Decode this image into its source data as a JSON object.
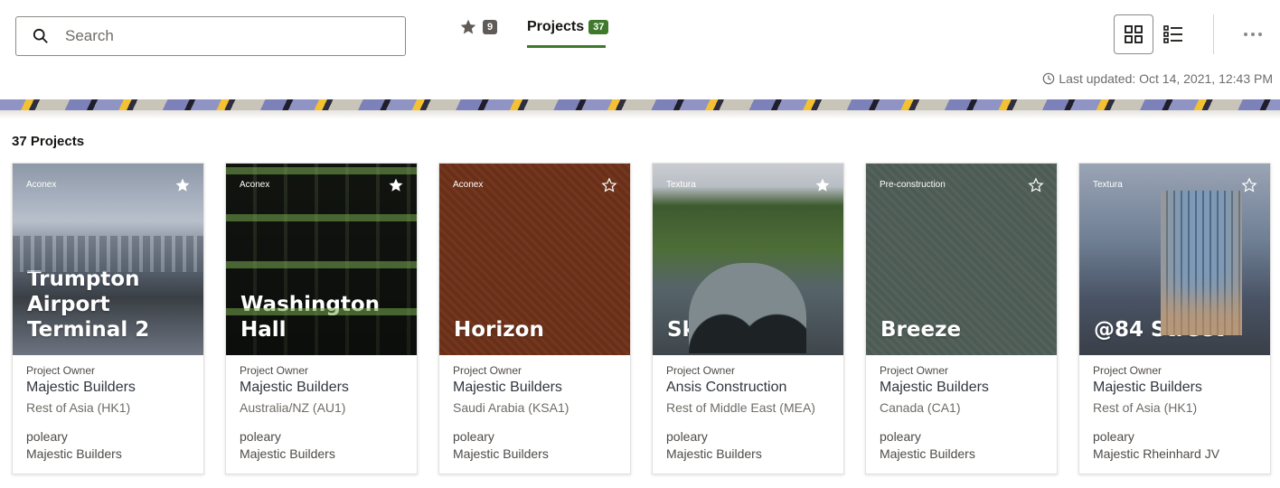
{
  "search": {
    "placeholder": "Search",
    "value": ""
  },
  "tabs": {
    "favorites": {
      "count": "9"
    },
    "projects": {
      "label": "Projects",
      "count": "37"
    }
  },
  "last_updated": "Last updated: Oct 14, 2021, 12:43 PM",
  "projects_heading": "37 Projects",
  "colors": {
    "accent": "#3f7a2c",
    "favorite_badge": "#605b56"
  },
  "cards": [
    {
      "tag": "Aconex",
      "favorited": true,
      "name": "Trumpton Airport Terminal 2",
      "owner_label": "Project Owner",
      "owner": "Majestic Builders",
      "region": "Rest of Asia (HK1)",
      "user": "poleary",
      "company": "Majestic Builders"
    },
    {
      "tag": "Aconex",
      "favorited": true,
      "name": "Washington Hall",
      "owner_label": "Project Owner",
      "owner": "Majestic Builders",
      "region": "Australia/NZ (AU1)",
      "user": "poleary",
      "company": "Majestic Builders"
    },
    {
      "tag": "Aconex",
      "favorited": false,
      "name": "Horizon",
      "owner_label": "Project Owner",
      "owner": "Majestic Builders",
      "region": "Saudi Arabia (KSA1)",
      "user": "poleary",
      "company": "Majestic Builders"
    },
    {
      "tag": "Textura",
      "favorited": true,
      "name": "Sky",
      "owner_label": "Project Owner",
      "owner": "Ansis Construction",
      "region": "Rest of Middle East (MEA)",
      "user": "poleary",
      "company": "Majestic Builders"
    },
    {
      "tag": "Pre-construction",
      "favorited": false,
      "name": "Breeze",
      "owner_label": "Project Owner",
      "owner": "Majestic Builders",
      "region": "Canada (CA1)",
      "user": "poleary",
      "company": "Majestic Builders"
    },
    {
      "tag": "Textura",
      "favorited": false,
      "name": "@84 Street",
      "owner_label": "Project Owner",
      "owner": "Majestic Builders",
      "region": "Rest of Asia (HK1)",
      "user": "poleary",
      "company": "Majestic Rheinhard JV"
    }
  ]
}
